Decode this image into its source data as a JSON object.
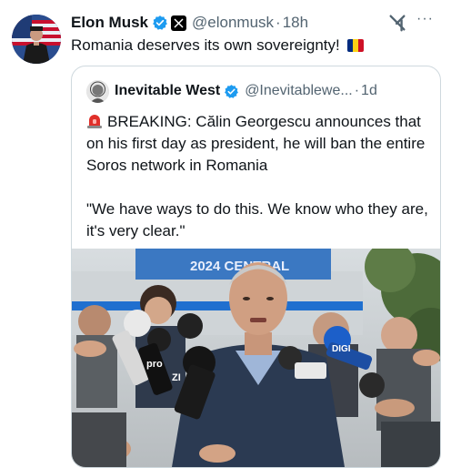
{
  "tweet": {
    "author_name": "Elon Musk",
    "handle": "@elonmusk",
    "separator": "·",
    "time": "18h",
    "text": "Romania deserves its own sovereignty!",
    "more_label": "···",
    "flag_colors": [
      "#002B7F",
      "#FCD116",
      "#CE1126"
    ]
  },
  "quoted_tweet": {
    "author_name": "Inevitable West",
    "handle": "@Inevitablewe...",
    "separator": "·",
    "time": "1d",
    "headline": "BREAKING: Călin Georgescu announces that on his first day as president, he will ban the entire Soros network in Romania",
    "quote": "\"We have ways to do this. We know who they are, it's very clear.\"",
    "photo_banner_text": "2024 CENTRAL",
    "photo_mic_labels": [
      "pro",
      "ZI",
      "DIGI"
    ]
  },
  "colors": {
    "verified": "#1d9bf0",
    "text_primary": "#0f1419",
    "text_secondary": "#536471",
    "border": "#cfd9de"
  }
}
